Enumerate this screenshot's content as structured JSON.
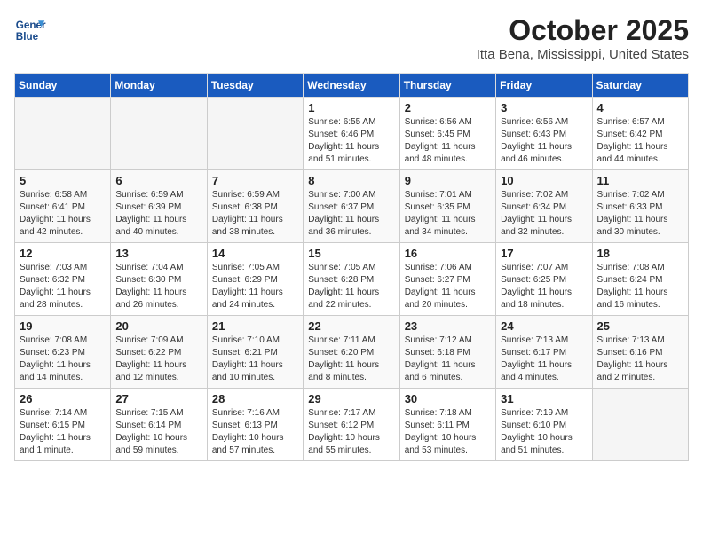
{
  "logo": {
    "line1": "General",
    "line2": "Blue"
  },
  "title": "October 2025",
  "location": "Itta Bena, Mississippi, United States",
  "weekdays": [
    "Sunday",
    "Monday",
    "Tuesday",
    "Wednesday",
    "Thursday",
    "Friday",
    "Saturday"
  ],
  "weeks": [
    [
      {
        "day": "",
        "sunrise": "",
        "sunset": "",
        "daylight": ""
      },
      {
        "day": "",
        "sunrise": "",
        "sunset": "",
        "daylight": ""
      },
      {
        "day": "",
        "sunrise": "",
        "sunset": "",
        "daylight": ""
      },
      {
        "day": "1",
        "sunrise": "Sunrise: 6:55 AM",
        "sunset": "Sunset: 6:46 PM",
        "daylight": "Daylight: 11 hours and 51 minutes."
      },
      {
        "day": "2",
        "sunrise": "Sunrise: 6:56 AM",
        "sunset": "Sunset: 6:45 PM",
        "daylight": "Daylight: 11 hours and 48 minutes."
      },
      {
        "day": "3",
        "sunrise": "Sunrise: 6:56 AM",
        "sunset": "Sunset: 6:43 PM",
        "daylight": "Daylight: 11 hours and 46 minutes."
      },
      {
        "day": "4",
        "sunrise": "Sunrise: 6:57 AM",
        "sunset": "Sunset: 6:42 PM",
        "daylight": "Daylight: 11 hours and 44 minutes."
      }
    ],
    [
      {
        "day": "5",
        "sunrise": "Sunrise: 6:58 AM",
        "sunset": "Sunset: 6:41 PM",
        "daylight": "Daylight: 11 hours and 42 minutes."
      },
      {
        "day": "6",
        "sunrise": "Sunrise: 6:59 AM",
        "sunset": "Sunset: 6:39 PM",
        "daylight": "Daylight: 11 hours and 40 minutes."
      },
      {
        "day": "7",
        "sunrise": "Sunrise: 6:59 AM",
        "sunset": "Sunset: 6:38 PM",
        "daylight": "Daylight: 11 hours and 38 minutes."
      },
      {
        "day": "8",
        "sunrise": "Sunrise: 7:00 AM",
        "sunset": "Sunset: 6:37 PM",
        "daylight": "Daylight: 11 hours and 36 minutes."
      },
      {
        "day": "9",
        "sunrise": "Sunrise: 7:01 AM",
        "sunset": "Sunset: 6:35 PM",
        "daylight": "Daylight: 11 hours and 34 minutes."
      },
      {
        "day": "10",
        "sunrise": "Sunrise: 7:02 AM",
        "sunset": "Sunset: 6:34 PM",
        "daylight": "Daylight: 11 hours and 32 minutes."
      },
      {
        "day": "11",
        "sunrise": "Sunrise: 7:02 AM",
        "sunset": "Sunset: 6:33 PM",
        "daylight": "Daylight: 11 hours and 30 minutes."
      }
    ],
    [
      {
        "day": "12",
        "sunrise": "Sunrise: 7:03 AM",
        "sunset": "Sunset: 6:32 PM",
        "daylight": "Daylight: 11 hours and 28 minutes."
      },
      {
        "day": "13",
        "sunrise": "Sunrise: 7:04 AM",
        "sunset": "Sunset: 6:30 PM",
        "daylight": "Daylight: 11 hours and 26 minutes."
      },
      {
        "day": "14",
        "sunrise": "Sunrise: 7:05 AM",
        "sunset": "Sunset: 6:29 PM",
        "daylight": "Daylight: 11 hours and 24 minutes."
      },
      {
        "day": "15",
        "sunrise": "Sunrise: 7:05 AM",
        "sunset": "Sunset: 6:28 PM",
        "daylight": "Daylight: 11 hours and 22 minutes."
      },
      {
        "day": "16",
        "sunrise": "Sunrise: 7:06 AM",
        "sunset": "Sunset: 6:27 PM",
        "daylight": "Daylight: 11 hours and 20 minutes."
      },
      {
        "day": "17",
        "sunrise": "Sunrise: 7:07 AM",
        "sunset": "Sunset: 6:25 PM",
        "daylight": "Daylight: 11 hours and 18 minutes."
      },
      {
        "day": "18",
        "sunrise": "Sunrise: 7:08 AM",
        "sunset": "Sunset: 6:24 PM",
        "daylight": "Daylight: 11 hours and 16 minutes."
      }
    ],
    [
      {
        "day": "19",
        "sunrise": "Sunrise: 7:08 AM",
        "sunset": "Sunset: 6:23 PM",
        "daylight": "Daylight: 11 hours and 14 minutes."
      },
      {
        "day": "20",
        "sunrise": "Sunrise: 7:09 AM",
        "sunset": "Sunset: 6:22 PM",
        "daylight": "Daylight: 11 hours and 12 minutes."
      },
      {
        "day": "21",
        "sunrise": "Sunrise: 7:10 AM",
        "sunset": "Sunset: 6:21 PM",
        "daylight": "Daylight: 11 hours and 10 minutes."
      },
      {
        "day": "22",
        "sunrise": "Sunrise: 7:11 AM",
        "sunset": "Sunset: 6:20 PM",
        "daylight": "Daylight: 11 hours and 8 minutes."
      },
      {
        "day": "23",
        "sunrise": "Sunrise: 7:12 AM",
        "sunset": "Sunset: 6:18 PM",
        "daylight": "Daylight: 11 hours and 6 minutes."
      },
      {
        "day": "24",
        "sunrise": "Sunrise: 7:13 AM",
        "sunset": "Sunset: 6:17 PM",
        "daylight": "Daylight: 11 hours and 4 minutes."
      },
      {
        "day": "25",
        "sunrise": "Sunrise: 7:13 AM",
        "sunset": "Sunset: 6:16 PM",
        "daylight": "Daylight: 11 hours and 2 minutes."
      }
    ],
    [
      {
        "day": "26",
        "sunrise": "Sunrise: 7:14 AM",
        "sunset": "Sunset: 6:15 PM",
        "daylight": "Daylight: 11 hours and 1 minute."
      },
      {
        "day": "27",
        "sunrise": "Sunrise: 7:15 AM",
        "sunset": "Sunset: 6:14 PM",
        "daylight": "Daylight: 10 hours and 59 minutes."
      },
      {
        "day": "28",
        "sunrise": "Sunrise: 7:16 AM",
        "sunset": "Sunset: 6:13 PM",
        "daylight": "Daylight: 10 hours and 57 minutes."
      },
      {
        "day": "29",
        "sunrise": "Sunrise: 7:17 AM",
        "sunset": "Sunset: 6:12 PM",
        "daylight": "Daylight: 10 hours and 55 minutes."
      },
      {
        "day": "30",
        "sunrise": "Sunrise: 7:18 AM",
        "sunset": "Sunset: 6:11 PM",
        "daylight": "Daylight: 10 hours and 53 minutes."
      },
      {
        "day": "31",
        "sunrise": "Sunrise: 7:19 AM",
        "sunset": "Sunset: 6:10 PM",
        "daylight": "Daylight: 10 hours and 51 minutes."
      },
      {
        "day": "",
        "sunrise": "",
        "sunset": "",
        "daylight": ""
      }
    ]
  ]
}
